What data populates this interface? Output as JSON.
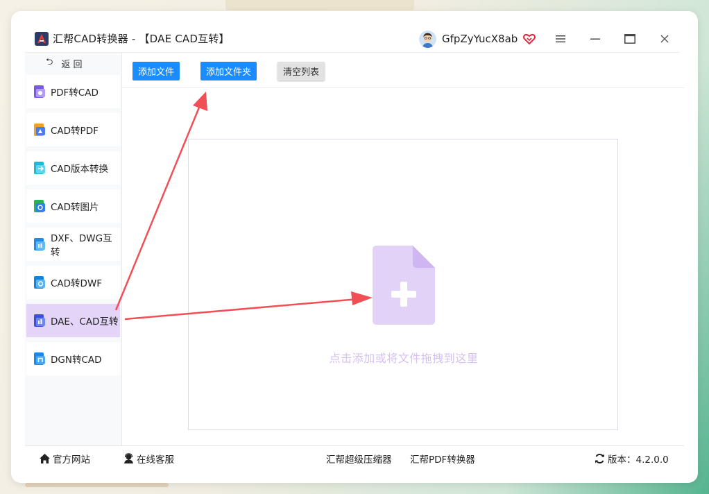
{
  "window": {
    "title": "汇帮CAD转换器 - 【DAE CAD互转】",
    "user": {
      "name": "GfpZyYucX8ab"
    }
  },
  "sidebar": {
    "back_label": "返 回",
    "items": [
      {
        "label": "PDF转CAD",
        "icon": "pdf-to-cad-icon"
      },
      {
        "label": "CAD转PDF",
        "icon": "cad-to-pdf-icon"
      },
      {
        "label": "CAD版本转换",
        "icon": "cad-version-icon"
      },
      {
        "label": "CAD转图片",
        "icon": "cad-to-image-icon"
      },
      {
        "label": "DXF、DWG互转",
        "icon": "dxf-dwg-icon"
      },
      {
        "label": "CAD转DWF",
        "icon": "cad-to-dwf-icon"
      },
      {
        "label": "DAE、CAD互转",
        "icon": "dae-cad-icon",
        "active": true
      },
      {
        "label": "DGN转CAD",
        "icon": "dgn-to-cad-icon"
      }
    ]
  },
  "toolbar": {
    "add_file": "添加文件",
    "add_folder": "添加文件夹",
    "clear_list": "清空列表"
  },
  "dropzone": {
    "hint": "点击添加或将文件拖拽到这里"
  },
  "footer": {
    "website": "官方网站",
    "support": "在线客服",
    "compressor": "汇帮超级压缩器",
    "pdf_converter": "汇帮PDF转换器",
    "version": "版本：4.2.0.0"
  },
  "colors": {
    "primary": "#1a8cff",
    "active_nav": "#e4d4f8",
    "drop_icon": "#e2d2f8",
    "drop_text": "#d5c0f2",
    "annotation_arrow": "#f24e55"
  }
}
